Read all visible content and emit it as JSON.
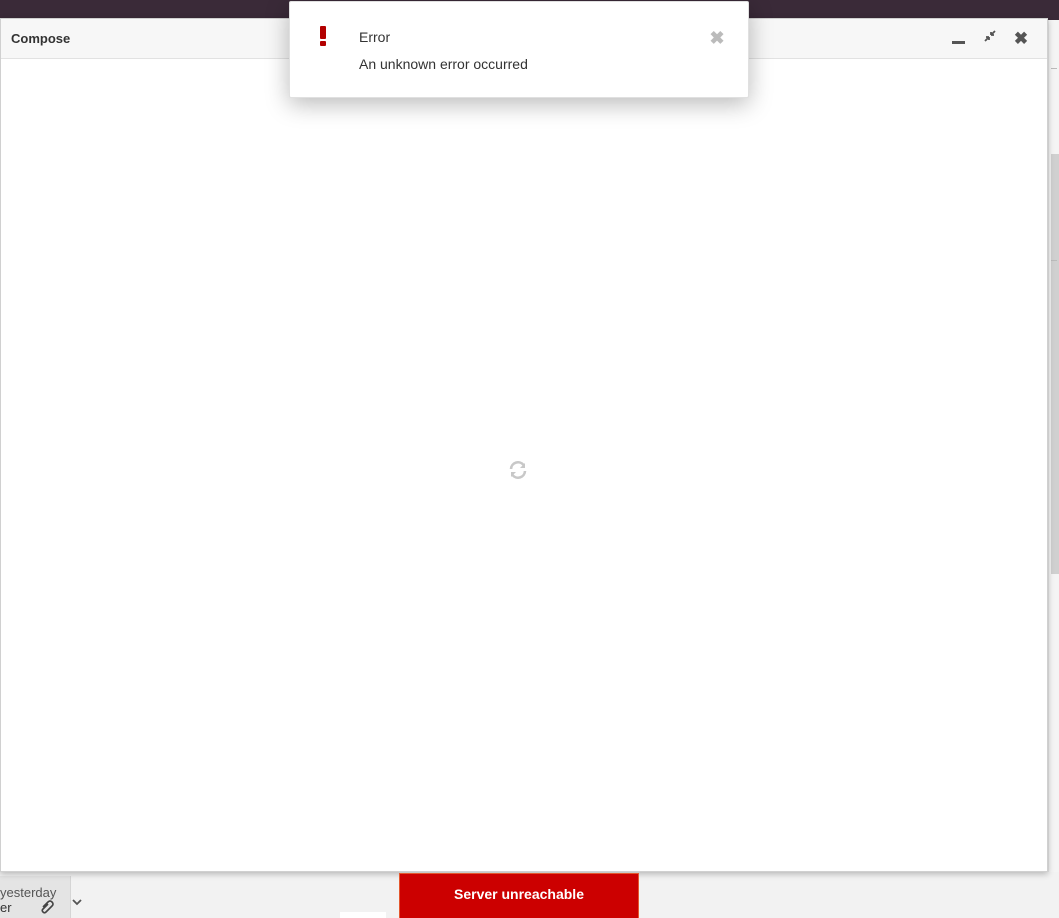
{
  "compose": {
    "title": "Compose",
    "minimize_symbol": "",
    "restore_symbol": "⤡",
    "close_symbol": "✖",
    "loading_icon": "refresh-icon"
  },
  "notification": {
    "icon": "exclamation-icon",
    "icon_color": "#b30000",
    "title": "Error",
    "message": "An unknown error occurred",
    "close_symbol": "✖"
  },
  "background_list": {
    "date": "yesterday",
    "sender": "er",
    "attachment_icon": "paperclip-icon",
    "expand_icon": "chevron-down-icon"
  },
  "status_banner": {
    "text": "Server unreachable",
    "color": "#cc0000"
  },
  "colors": {
    "topbar": "#3a2a38",
    "accent_error": "#cc0000"
  }
}
